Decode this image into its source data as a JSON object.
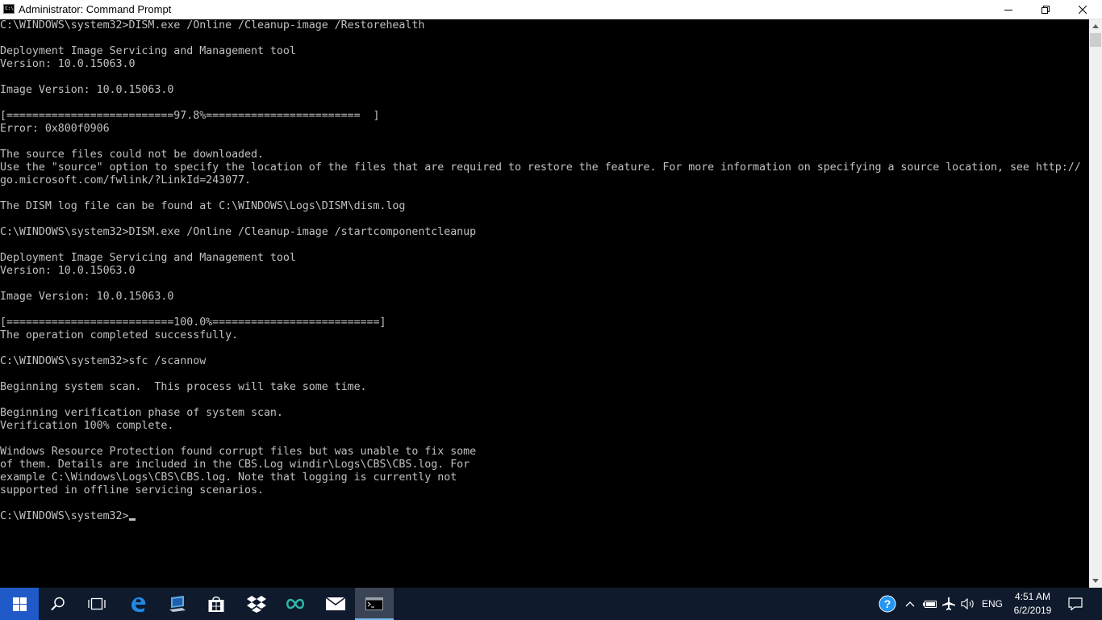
{
  "window": {
    "title": "Administrator: Command Prompt",
    "app_icon_text": "C:\\"
  },
  "console": {
    "lines": [
      "C:\\WINDOWS\\system32>DISM.exe /Online /Cleanup-image /Restorehealth",
      "",
      "Deployment Image Servicing and Management tool",
      "Version: 10.0.15063.0",
      "",
      "Image Version: 10.0.15063.0",
      "",
      "[==========================97.8%========================  ]",
      "Error: 0x800f0906",
      "",
      "The source files could not be downloaded.",
      "Use the \"source\" option to specify the location of the files that are required to restore the feature. For more information on specifying a source location, see http://",
      "go.microsoft.com/fwlink/?LinkId=243077.",
      "",
      "The DISM log file can be found at C:\\WINDOWS\\Logs\\DISM\\dism.log",
      "",
      "C:\\WINDOWS\\system32>DISM.exe /Online /Cleanup-image /startcomponentcleanup",
      "",
      "Deployment Image Servicing and Management tool",
      "Version: 10.0.15063.0",
      "",
      "Image Version: 10.0.15063.0",
      "",
      "[==========================100.0%==========================]",
      "The operation completed successfully.",
      "",
      "C:\\WINDOWS\\system32>sfc /scannow",
      "",
      "Beginning system scan.  This process will take some time.",
      "",
      "Beginning verification phase of system scan.",
      "Verification 100% complete.",
      "",
      "Windows Resource Protection found corrupt files but was unable to fix some",
      "of them. Details are included in the CBS.Log windir\\Logs\\CBS\\CBS.log. For",
      "example C:\\Windows\\Logs\\CBS\\CBS.log. Note that logging is currently not",
      "supported in offline servicing scenarios.",
      ""
    ],
    "prompt": "C:\\WINDOWS\\system32>"
  },
  "taskbar": {
    "apps": [
      "start-icon",
      "search-icon",
      "task-view-icon",
      "edge-icon",
      "computer-icon",
      "store-icon",
      "dropbox-icon",
      "arduino-icon",
      "mail-icon",
      "command-prompt-icon"
    ],
    "tray": {
      "language": "ENG",
      "time": "4:51 AM",
      "date": "6/2/2019"
    }
  },
  "colors": {
    "console_bg": "#000000",
    "console_text": "#c0c0c0",
    "taskbar_bg": "#0f1a2d",
    "start_bg": "#1f5ac8",
    "accent": "#76b9ed"
  }
}
